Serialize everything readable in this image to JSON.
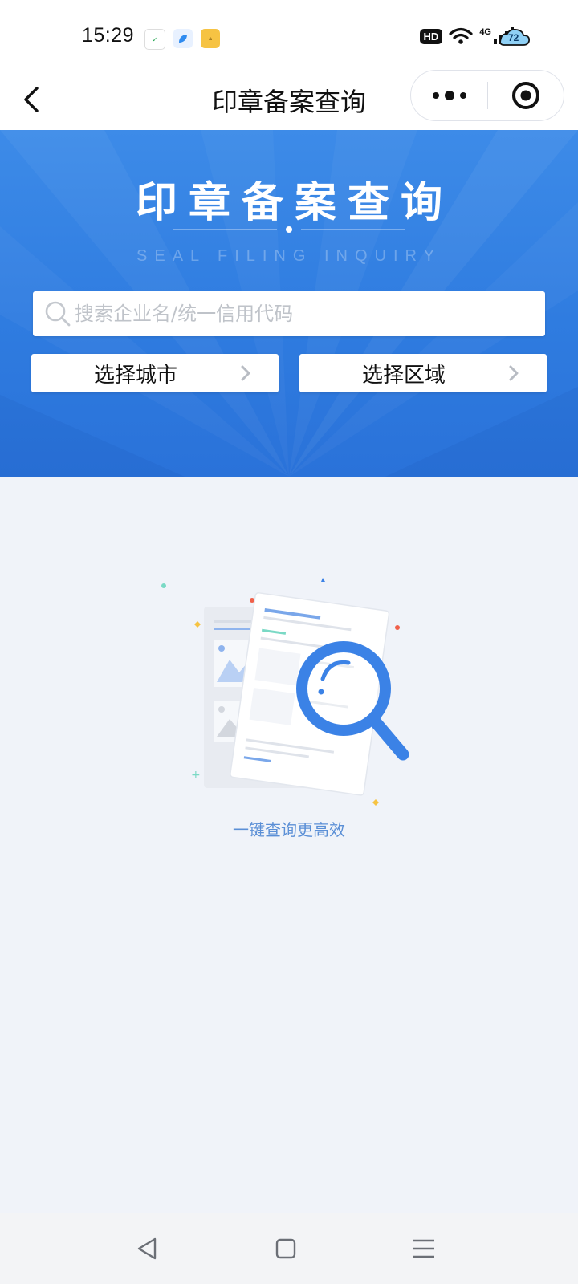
{
  "status_bar": {
    "time": "15:29",
    "hd_badge": "HD",
    "network": "4G",
    "battery_level": "72",
    "icons": [
      "notification-app-icon",
      "browser-app-icon",
      "store-app-icon",
      "wifi-icon",
      "signal-icon",
      "battery-icon"
    ]
  },
  "nav": {
    "title": "印章备案查询",
    "back_icon": "chevron-left-icon",
    "more_icon": "more-dots-icon",
    "close_icon": "target-close-icon"
  },
  "banner": {
    "title": "印章备案查询",
    "subtitle": "SEAL FILING INQUIRY"
  },
  "search": {
    "placeholder": "搜索企业名/统一信用代码",
    "value": ""
  },
  "filters": {
    "city_label": "选择城市",
    "area_label": "选择区域"
  },
  "empty_state": {
    "text": "一键查询更高效"
  },
  "colors": {
    "banner_top": "#3d8be8",
    "banner_bottom": "#2a72d9",
    "page_bg": "#f0f3f9",
    "accent": "#3b82e6",
    "hint_text": "#5b8fd6"
  }
}
